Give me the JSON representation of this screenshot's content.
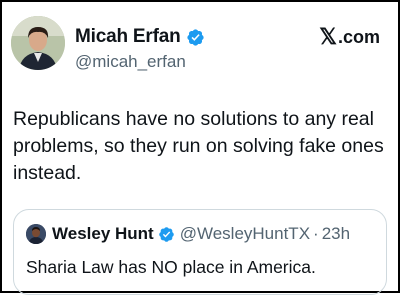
{
  "tweet": {
    "author": {
      "display_name": "Micah Erfan",
      "handle": "@micah_erfan",
      "verified_icon": "verified-badge-icon"
    },
    "brand": {
      "x_glyph": "𝕏",
      "domain": ".com"
    },
    "text": "Republicans have no solutions to any real problems, so they run on solving fake ones instead.",
    "quoted": {
      "display_name": "Wesley Hunt",
      "handle": "@WesleyHuntTX",
      "separator": "·",
      "time": "23h",
      "text": "Sharia Law has NO place in America."
    }
  },
  "colors": {
    "verified_blue": "#1d9bf0",
    "text_primary": "#0f1419",
    "text_secondary": "#536471",
    "border": "#cfd9de"
  }
}
